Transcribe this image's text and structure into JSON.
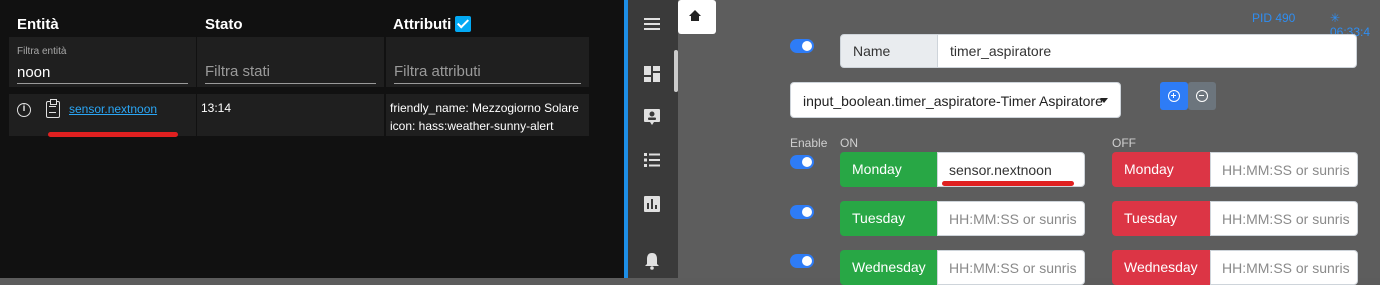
{
  "left": {
    "headers": {
      "entity": "Entità",
      "state": "Stato",
      "attributes": "Attributi"
    },
    "filters": {
      "entity_label": "Filtra entità",
      "entity_value": "noon",
      "state_placeholder": "Filtra stati",
      "attributes_placeholder": "Filtra attributi"
    },
    "row": {
      "entity": "sensor.nextnoon",
      "state": "13:14",
      "attr_line1": "friendly_name: Mezzogiorno Solare",
      "attr_line2": "icon: hass:weather-sunny-alert"
    }
  },
  "sidebar": {
    "icons": [
      "menu-icon",
      "dashboard-icon",
      "account-box-icon",
      "list-icon",
      "chart-icon",
      "bell-icon"
    ]
  },
  "right": {
    "status": {
      "pid": "PID 490",
      "time": "✳ 06:33:4"
    },
    "name_label": "Name",
    "name_value": "timer_aspiratore",
    "select_value": "input_boolean.timer_aspiratore-Timer Aspiratore",
    "labels": {
      "enable": "Enable",
      "on": "ON",
      "off": "OFF"
    },
    "days": [
      {
        "name": "Monday",
        "on_value": "sensor.nextnoon",
        "on_placeholder": "",
        "off_placeholder": "HH:MM:SS or sunris"
      },
      {
        "name": "Tuesday",
        "on_value": "",
        "on_placeholder": "HH:MM:SS or sunris",
        "off_placeholder": "HH:MM:SS or sunris"
      },
      {
        "name": "Wednesday",
        "on_value": "",
        "on_placeholder": "HH:MM:SS or sunris",
        "off_placeholder": "HH:MM:SS or sunris"
      }
    ],
    "colors": {
      "accent": "#2e7cf6",
      "on": "#28a745",
      "off": "#dc3545",
      "annotation": "#e02020"
    }
  }
}
